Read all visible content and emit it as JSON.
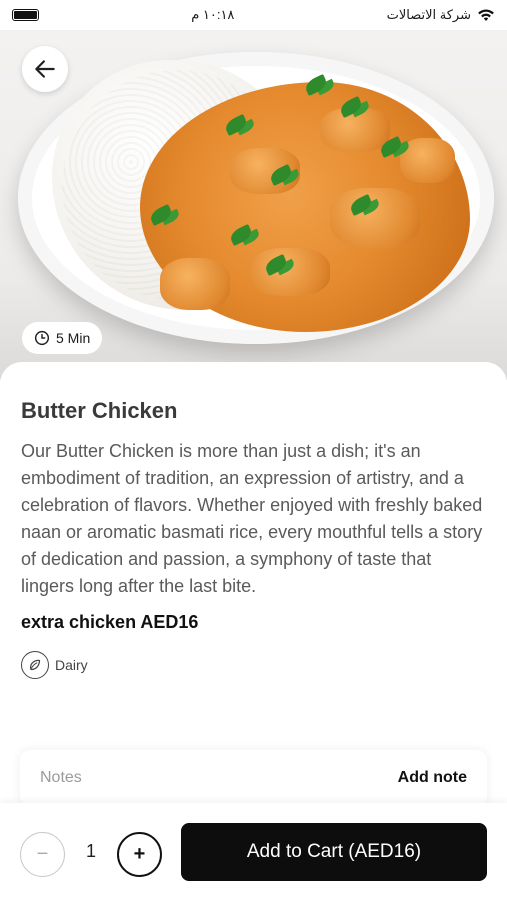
{
  "status_bar": {
    "time": "١٠:١٨ م",
    "carrier": "شركة الاتصالات"
  },
  "hero": {
    "image_alt": "Butter chicken with rice",
    "prep_time": "5 Min"
  },
  "dish": {
    "title": "Butter Chicken",
    "description": "Our Butter Chicken is more than just a dish; it's an embodiment of tradition, an expression of artistry, and a celebration of flavors. Whether enjoyed with freshly baked naan or aromatic basmati rice, every mouthful tells a story of dedication and passion, a symphony of taste that lingers long after the last bite.",
    "extra": "extra chicken AED16",
    "allergens": [
      {
        "label": "Dairy",
        "icon": "dairy-icon"
      }
    ]
  },
  "notes": {
    "label": "Notes",
    "action": "Add note"
  },
  "cart": {
    "quantity": "1",
    "minus": "−",
    "plus": "+",
    "add_label": "Add to Cart (AED16)"
  },
  "colors": {
    "primary_button": "#0d0d0d",
    "text_muted": "#5a5a5a",
    "curry": "#e58a2e"
  }
}
